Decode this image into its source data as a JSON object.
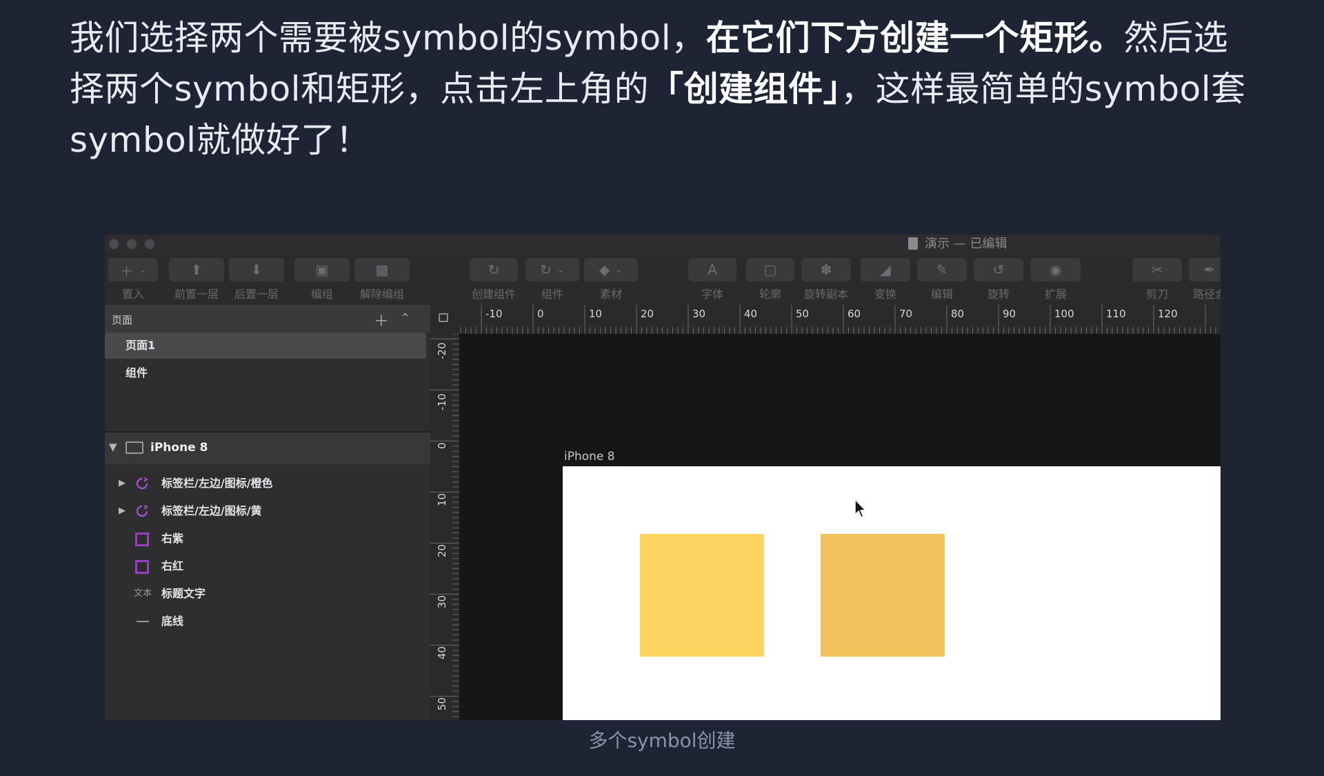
{
  "article": {
    "p1": "我们选择两个需要被symbol的symbol，",
    "p1_bold": "在它们下方创建一个矩形。",
    "p2": "然后选择两个symbol和矩形，点击左上角的",
    "p2_bold": "「创建组件」",
    "p3": "，这样最简单的symbol套symbol就做好了！"
  },
  "window": {
    "title": "演示 — 已编辑",
    "toolbar": [
      {
        "label": "置入",
        "icon": "plus-icon",
        "glyph": "＋",
        "has_menu": true
      },
      {
        "label": "前置一层",
        "icon": "bring-forward-icon",
        "glyph": "⬆"
      },
      {
        "label": "后置一层",
        "icon": "send-backward-icon",
        "glyph": "⬇"
      },
      {
        "label": "编组",
        "icon": "group-icon",
        "glyph": "▣"
      },
      {
        "label": "解除编组",
        "icon": "ungroup-icon",
        "glyph": "▩"
      },
      {
        "label": "创建组件",
        "icon": "create-symbol-icon",
        "glyph": "↻"
      },
      {
        "label": "组件",
        "icon": "symbols-icon",
        "glyph": "↻",
        "has_menu": true
      },
      {
        "label": "素材",
        "icon": "layers-icon",
        "glyph": "◆",
        "has_menu": true
      },
      {
        "label": "字体",
        "icon": "font-icon",
        "glyph": "A"
      },
      {
        "label": "轮廓",
        "icon": "outline-icon",
        "glyph": "▢"
      },
      {
        "label": "旋转副本",
        "icon": "rotate-copies-icon",
        "glyph": "✽"
      },
      {
        "label": "变换",
        "icon": "transform-icon",
        "glyph": "◢"
      },
      {
        "label": "编辑",
        "icon": "edit-icon",
        "glyph": "✎"
      },
      {
        "label": "旋转",
        "icon": "rotate-icon",
        "glyph": "↺"
      },
      {
        "label": "扩展",
        "icon": "flatten-icon",
        "glyph": "◉"
      },
      {
        "label": "剪刀",
        "icon": "scissors-icon",
        "glyph": "✂"
      },
      {
        "label": "路径含",
        "icon": "path-icon",
        "glyph": "✒"
      }
    ]
  },
  "sidebar": {
    "pages_label": "页面",
    "pages": [
      {
        "label": "页面1",
        "selected": true
      },
      {
        "label": "组件",
        "selected": false
      }
    ],
    "artboard": "iPhone 8",
    "layers": [
      {
        "label": "标签栏/左边/图标/橙色",
        "type": "symbol"
      },
      {
        "label": "标签栏/左边/图标/黄",
        "type": "symbol"
      },
      {
        "label": "右紫",
        "type": "shape"
      },
      {
        "label": "右红",
        "type": "shape"
      },
      {
        "label": "标题文字",
        "type": "text",
        "type_badge": "文本"
      },
      {
        "label": "底线",
        "type": "line"
      }
    ]
  },
  "rulers": {
    "h_labels": [
      "-10",
      "0",
      "10",
      "20",
      "30",
      "40",
      "50",
      "60",
      "70",
      "80",
      "90",
      "100",
      "110",
      "120"
    ],
    "v_labels": [
      "-20",
      "-10",
      "0",
      "10",
      "20",
      "30",
      "40",
      "50"
    ]
  },
  "canvas": {
    "artboard_label": "iPhone 8",
    "square_colors": [
      "#fed562",
      "#f2c35c"
    ]
  },
  "caption": "多个symbol创建",
  "colors": {
    "background": "#1e2434",
    "symbol_icon": "#b04fd8",
    "shape_icon": "#9b3fc2"
  }
}
